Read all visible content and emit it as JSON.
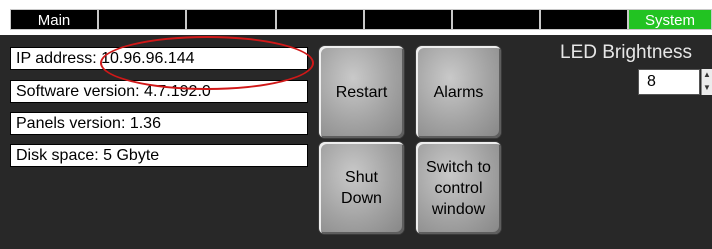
{
  "tabs": [
    {
      "label": "Main"
    },
    {
      "label": ""
    },
    {
      "label": ""
    },
    {
      "label": ""
    },
    {
      "label": ""
    },
    {
      "label": ""
    },
    {
      "label": ""
    },
    {
      "label": "System"
    }
  ],
  "active_tab": "System",
  "info": {
    "ip": "IP address: 10.96.96.144",
    "software": "Software version: 4.7.192.0",
    "panels": "Panels version: 1.36",
    "disk": "Disk space: 5 Gbyte"
  },
  "buttons": {
    "restart": "Restart",
    "alarms": "Alarms",
    "shutdown": "Shut\nDown",
    "switch": "Switch to\ncontrol\nwindow"
  },
  "led": {
    "label": "LED Brightness",
    "value": "8"
  },
  "colors": {
    "background": "#282828",
    "active_tab": "#22c322",
    "annotation": "#d01818"
  }
}
